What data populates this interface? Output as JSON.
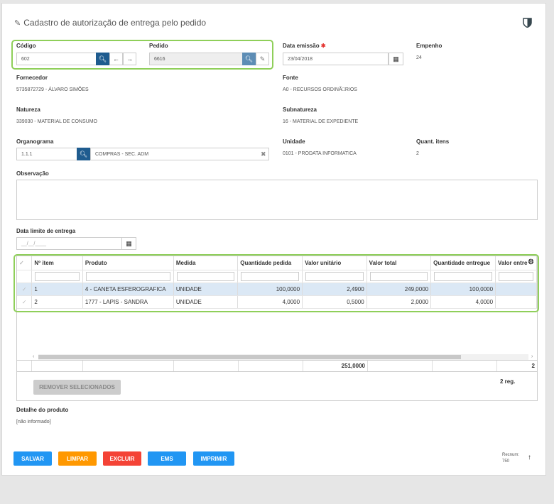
{
  "header": {
    "title": "Cadastro de autorização de entrega pelo pedido",
    "edit_icon": "edit-icon",
    "shield_icon": "shield-icon"
  },
  "codigo": {
    "label": "Código",
    "value": "602"
  },
  "pedido": {
    "label": "Pedido",
    "value": "6616"
  },
  "data_emissao": {
    "label": "Data emissão",
    "required": "✱",
    "value": "23/04/2018"
  },
  "empenho": {
    "label": "Empenho",
    "value": "24"
  },
  "fornecedor": {
    "label": "Fornecedor",
    "value": "5735872729 - ÁLVARO SIMÕES"
  },
  "fonte": {
    "label": "Fonte",
    "value": "A0 - RECURSOS ORDINÃ□RIOS"
  },
  "natureza": {
    "label": "Natureza",
    "value": "339030 - MATERIAL DE CONSUMO"
  },
  "subnatureza": {
    "label": "Subnatureza",
    "value": "16 - MATERIAL DE EXPEDIENTE"
  },
  "organograma": {
    "label": "Organograma",
    "code": "1.1.1",
    "desc": "COMPRAS - SEC. ADM"
  },
  "unidade": {
    "label": "Unidade",
    "value": "0101 - PRODATA INFORMATICA"
  },
  "quant_itens": {
    "label": "Quant. itens",
    "value": "2"
  },
  "observacao": {
    "label": "Observação",
    "value": ""
  },
  "data_limite": {
    "label": "Data limite de entrega",
    "placeholder": "__/__/____"
  },
  "grid": {
    "columns": [
      "Nº item",
      "Produto",
      "Medida",
      "Quantidade pedida",
      "Valor unitário",
      "Valor total",
      "Quantidade entregue",
      "Valor entre"
    ],
    "rows": [
      [
        "1",
        "4 - CANETA ESFEROGRAFICA",
        "UNIDADE",
        "100,0000",
        "2,4900",
        "249,0000",
        "100,0000",
        ""
      ],
      [
        "2",
        "1777 - LAPIS - SANDRA",
        "UNIDADE",
        "4,0000",
        "0,5000",
        "2,0000",
        "4,0000",
        ""
      ]
    ],
    "footer_total": "251,0000",
    "footer_last": "2",
    "remove_label": "REMOVER SELECIONADOS",
    "reg_count": "2 reg."
  },
  "detalhe": {
    "label": "Detalhe do produto",
    "value": "[não informado]"
  },
  "actions": {
    "salvar": "SALVAR",
    "limpar": "LIMPAR",
    "excluir": "EXCLUIR",
    "ems": "EMS",
    "imprimir": "IMPRIMIR"
  },
  "recnum": {
    "label": "Recnum:",
    "value": "750"
  },
  "colors": {
    "primary": "#1f5c8f",
    "save": "#2196f3",
    "clear": "#ff9800",
    "delete": "#f44336",
    "highlight": "#8fcf5a"
  }
}
